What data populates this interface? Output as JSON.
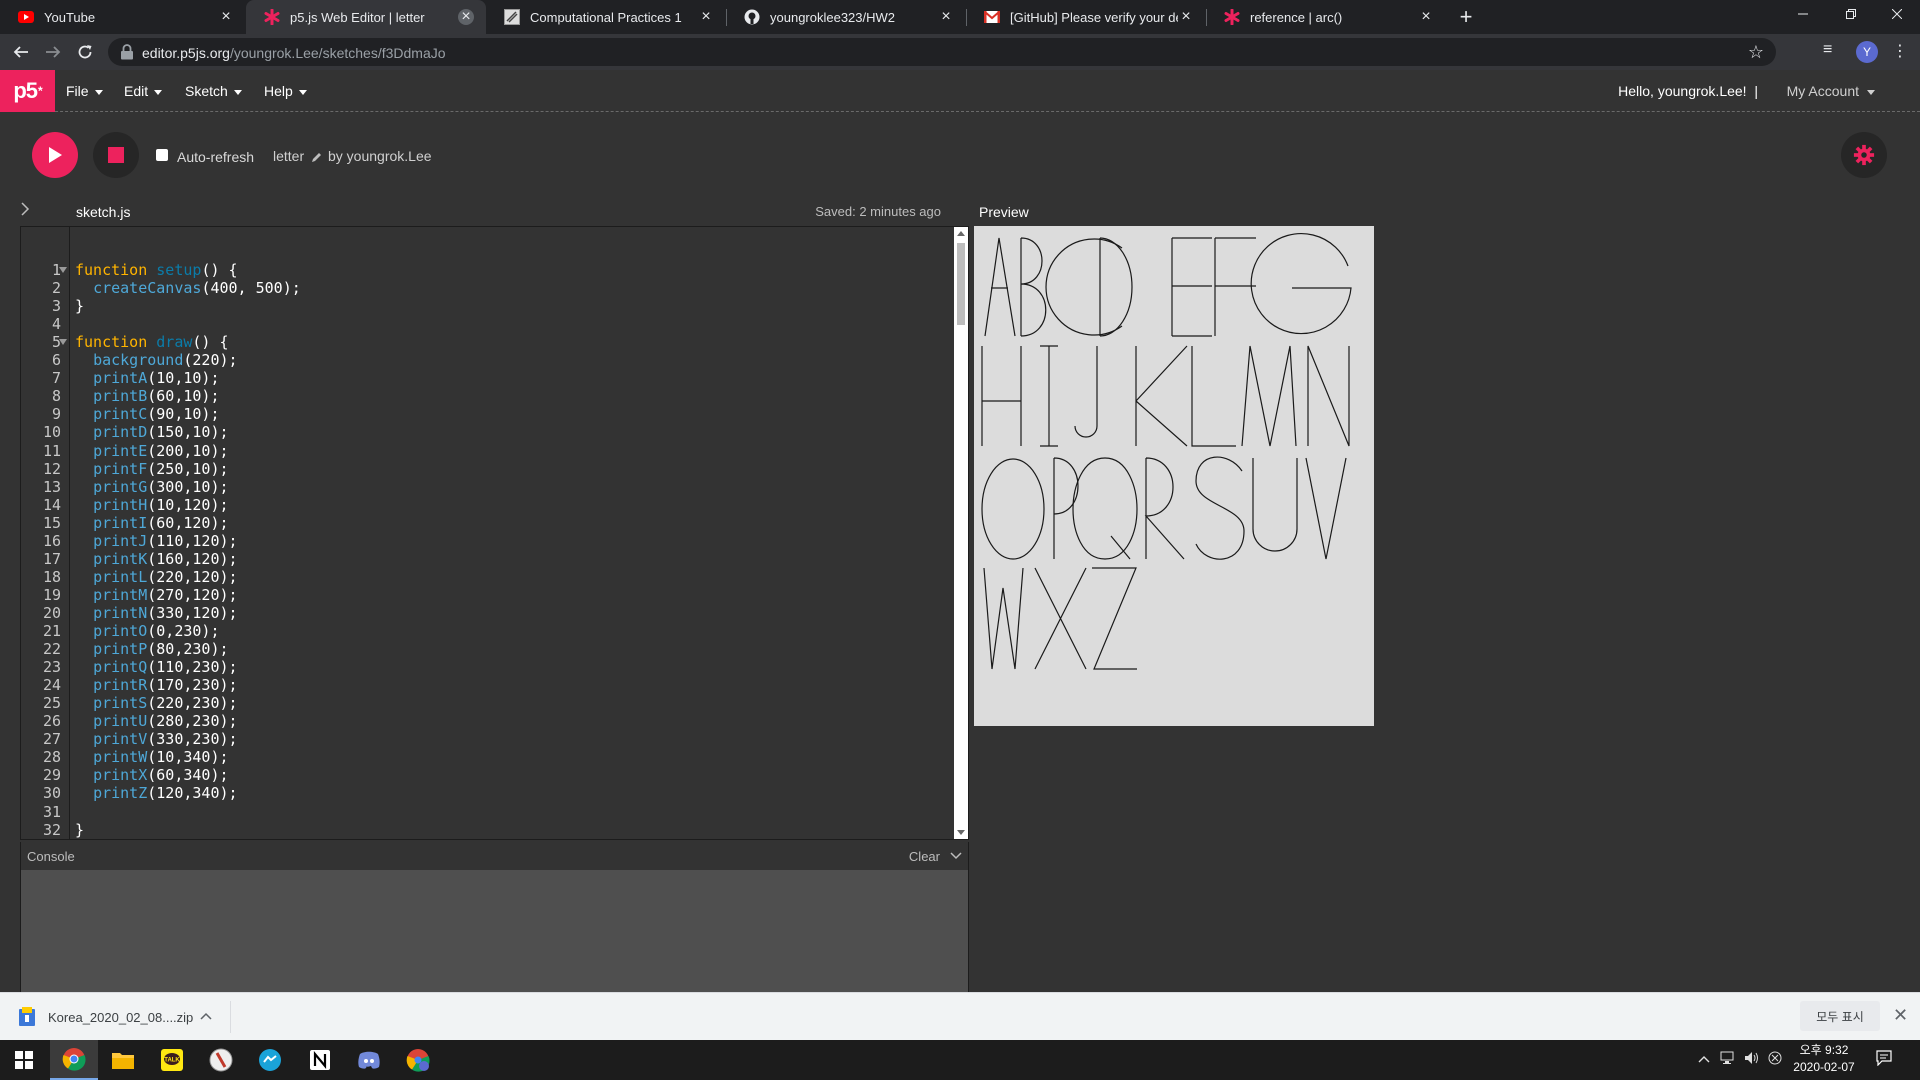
{
  "browser": {
    "tabs": [
      {
        "title": "YouTube",
        "icon": "youtube-icon",
        "active": false
      },
      {
        "title": "p5.js Web Editor | letter",
        "icon": "p5-asterisk-icon",
        "active": true
      },
      {
        "title": "Computational Practices 1",
        "icon": "sketch-site-icon",
        "active": false
      },
      {
        "title": "youngroklee323/HW2",
        "icon": "github-icon",
        "active": false
      },
      {
        "title": "[GitHub] Please verify your devi",
        "icon": "gmail-icon",
        "active": false
      },
      {
        "title": "reference | arc()",
        "icon": "p5-asterisk-icon",
        "active": false
      }
    ],
    "url_host": "editor.p5js.org",
    "url_path": "/youngrok.Lee/sketches/f3DdmaJo",
    "profile_initial": "Y"
  },
  "p5": {
    "logo": "p5",
    "logo_mark": "*",
    "menus": [
      "File",
      "Edit",
      "Sketch",
      "Help"
    ],
    "greeting": "Hello, youngrok.Lee!",
    "greeting_sep": "|",
    "account": "My Account",
    "auto_refresh_label": "Auto-refresh",
    "auto_refresh_checked": false,
    "sketch_name": "letter",
    "byline": "by youngrok.Lee",
    "file_name": "sketch.js",
    "saved_status": "Saved: 2 minutes ago",
    "preview_label": "Preview",
    "console_label": "Console",
    "console_clear": "Clear",
    "accent_color": "#ed225d"
  },
  "code": {
    "lines": [
      [
        [
          "kw",
          "function "
        ],
        [
          "fn",
          "setup"
        ],
        [
          "t",
          "() {"
        ]
      ],
      [
        [
          "t",
          "  "
        ],
        [
          "call",
          "createCanvas"
        ],
        [
          "t",
          "(400, 500);"
        ]
      ],
      [
        [
          "t",
          "}"
        ]
      ],
      [],
      [
        [
          "kw",
          "function "
        ],
        [
          "fn",
          "draw"
        ],
        [
          "t",
          "() {"
        ]
      ],
      [
        [
          "t",
          "  "
        ],
        [
          "call",
          "background"
        ],
        [
          "t",
          "(220);"
        ]
      ],
      [
        [
          "t",
          "  "
        ],
        [
          "call",
          "printA"
        ],
        [
          "t",
          "(10,10);"
        ]
      ],
      [
        [
          "t",
          "  "
        ],
        [
          "call",
          "printB"
        ],
        [
          "t",
          "(60,10);"
        ]
      ],
      [
        [
          "t",
          "  "
        ],
        [
          "call",
          "printC"
        ],
        [
          "t",
          "(90,10);"
        ]
      ],
      [
        [
          "t",
          "  "
        ],
        [
          "call",
          "printD"
        ],
        [
          "t",
          "(150,10);"
        ]
      ],
      [
        [
          "t",
          "  "
        ],
        [
          "call",
          "printE"
        ],
        [
          "t",
          "(200,10);"
        ]
      ],
      [
        [
          "t",
          "  "
        ],
        [
          "call",
          "printF"
        ],
        [
          "t",
          "(250,10);"
        ]
      ],
      [
        [
          "t",
          "  "
        ],
        [
          "call",
          "printG"
        ],
        [
          "t",
          "(300,10);"
        ]
      ],
      [
        [
          "t",
          "  "
        ],
        [
          "call",
          "printH"
        ],
        [
          "t",
          "(10,120);"
        ]
      ],
      [
        [
          "t",
          "  "
        ],
        [
          "call",
          "printI"
        ],
        [
          "t",
          "(60,120);"
        ]
      ],
      [
        [
          "t",
          "  "
        ],
        [
          "call",
          "printJ"
        ],
        [
          "t",
          "(110,120);"
        ]
      ],
      [
        [
          "t",
          "  "
        ],
        [
          "call",
          "printK"
        ],
        [
          "t",
          "(160,120);"
        ]
      ],
      [
        [
          "t",
          "  "
        ],
        [
          "call",
          "printL"
        ],
        [
          "t",
          "(220,120);"
        ]
      ],
      [
        [
          "t",
          "  "
        ],
        [
          "call",
          "printM"
        ],
        [
          "t",
          "(270,120);"
        ]
      ],
      [
        [
          "t",
          "  "
        ],
        [
          "call",
          "printN"
        ],
        [
          "t",
          "(330,120);"
        ]
      ],
      [
        [
          "t",
          "  "
        ],
        [
          "call",
          "printO"
        ],
        [
          "t",
          "(0,230);"
        ]
      ],
      [
        [
          "t",
          "  "
        ],
        [
          "call",
          "printP"
        ],
        [
          "t",
          "(80,230);"
        ]
      ],
      [
        [
          "t",
          "  "
        ],
        [
          "call",
          "printQ"
        ],
        [
          "t",
          "(110,230);"
        ]
      ],
      [
        [
          "t",
          "  "
        ],
        [
          "call",
          "printR"
        ],
        [
          "t",
          "(170,230);"
        ]
      ],
      [
        [
          "t",
          "  "
        ],
        [
          "call",
          "printS"
        ],
        [
          "t",
          "(220,230);"
        ]
      ],
      [
        [
          "t",
          "  "
        ],
        [
          "call",
          "printU"
        ],
        [
          "t",
          "(280,230);"
        ]
      ],
      [
        [
          "t",
          "  "
        ],
        [
          "call",
          "printV"
        ],
        [
          "t",
          "(330,230);"
        ]
      ],
      [
        [
          "t",
          "  "
        ],
        [
          "call",
          "printW"
        ],
        [
          "t",
          "(10,340);"
        ]
      ],
      [
        [
          "t",
          "  "
        ],
        [
          "call",
          "printX"
        ],
        [
          "t",
          "(60,340);"
        ]
      ],
      [
        [
          "t",
          "  "
        ],
        [
          "call",
          "printZ"
        ],
        [
          "t",
          "(120,340);"
        ]
      ],
      [],
      [
        [
          "t",
          "}"
        ]
      ],
      []
    ],
    "fold_lines": [
      1,
      5
    ]
  },
  "download": {
    "file": "Korea_2020_02_08....zip",
    "show_all": "모두 표시"
  },
  "taskbar": {
    "apps": [
      "windows-start-icon",
      "chrome-icon",
      "file-explorer-icon",
      "kakaotalk-icon",
      "app-icon",
      "messenger-icon",
      "notion-icon",
      "discord-icon",
      "chrome-profile-icon"
    ],
    "time": "오후 9:32",
    "date": "2020-02-07"
  }
}
